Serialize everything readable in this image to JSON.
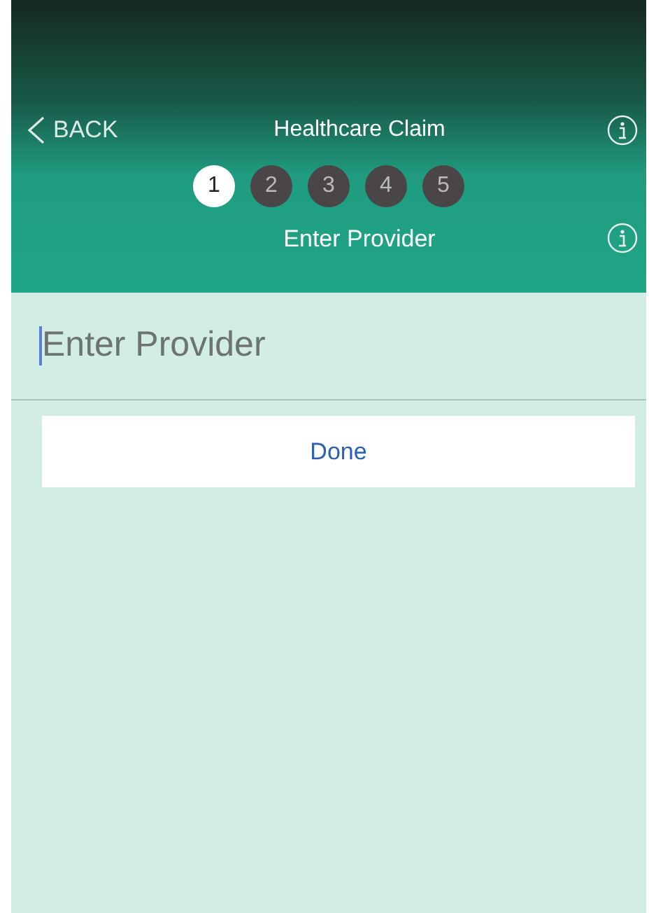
{
  "header": {
    "back_label": "BACK",
    "title": "Healthcare Claim",
    "subtitle": "Enter Provider"
  },
  "steps": [
    {
      "label": "1",
      "selected": true
    },
    {
      "label": "2",
      "selected": false
    },
    {
      "label": "3",
      "selected": false
    },
    {
      "label": "4",
      "selected": false
    },
    {
      "label": "5",
      "selected": false
    }
  ],
  "provider_field": {
    "placeholder": "Enter Provider",
    "focused": true
  },
  "buttons": [
    "Done"
  ]
}
